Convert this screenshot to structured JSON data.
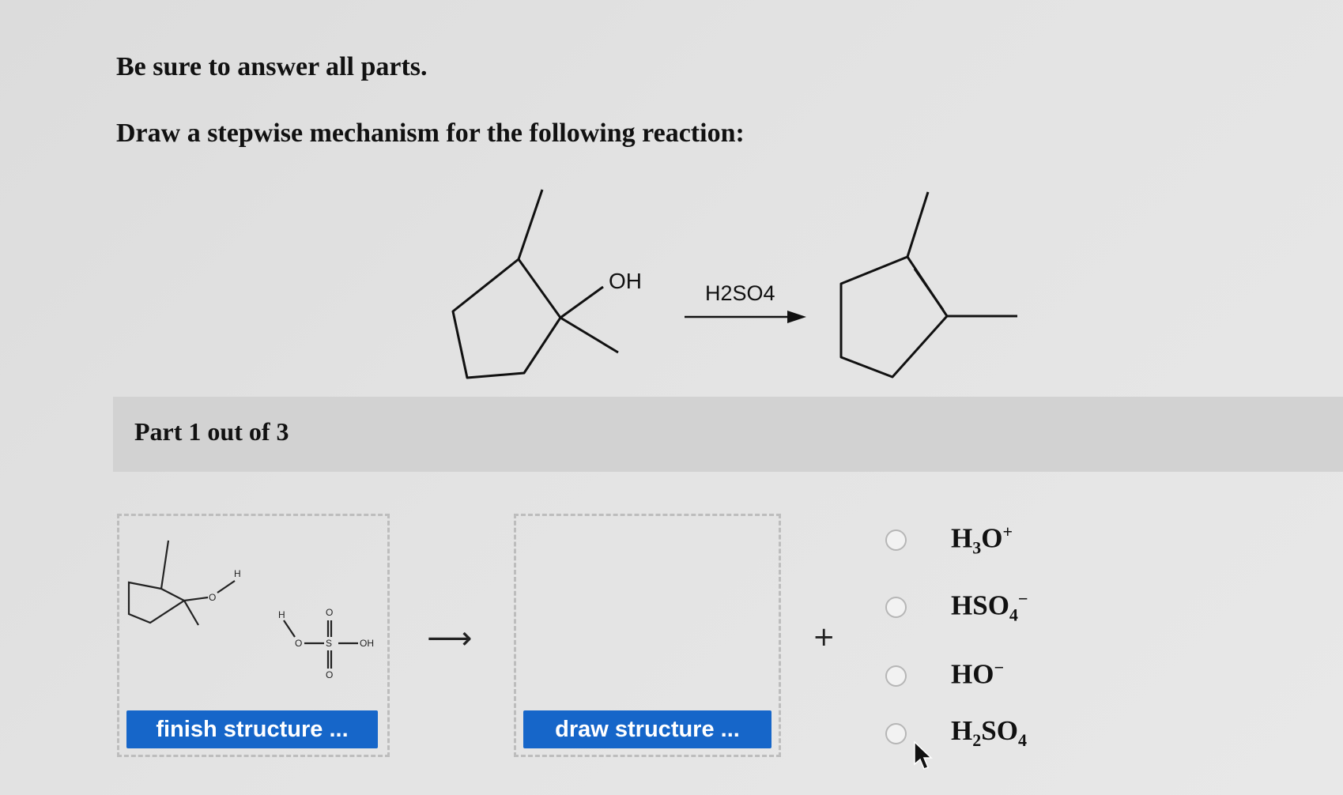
{
  "instructions": {
    "line1": "Be sure to answer all parts.",
    "line2": "Draw a stepwise mechanism for the following reaction:"
  },
  "reaction": {
    "substituent": "OH",
    "reagent": "H2SO4"
  },
  "part": {
    "title": "Part 1 out of 3"
  },
  "workspace": {
    "box1_labels": {
      "h1": "H",
      "o1": "O",
      "h2": "H",
      "o2": "O",
      "s": "S",
      "o_top": "O",
      "o_bottom": "O",
      "oh": "OH"
    },
    "finish_button": "finish structure ...",
    "arrow": "⟶",
    "draw_button": "draw structure ...",
    "plus": "+"
  },
  "options": [
    {
      "base": "H",
      "sub": "3",
      "rest": "O",
      "sup": "+"
    },
    {
      "base": "HSO",
      "sub": "4",
      "rest": "",
      "sup": "−"
    },
    {
      "base": "HO",
      "sub": "",
      "rest": "",
      "sup": "−"
    },
    {
      "base": "H",
      "sub": "2",
      "rest": "SO",
      "sub2": "4"
    }
  ]
}
